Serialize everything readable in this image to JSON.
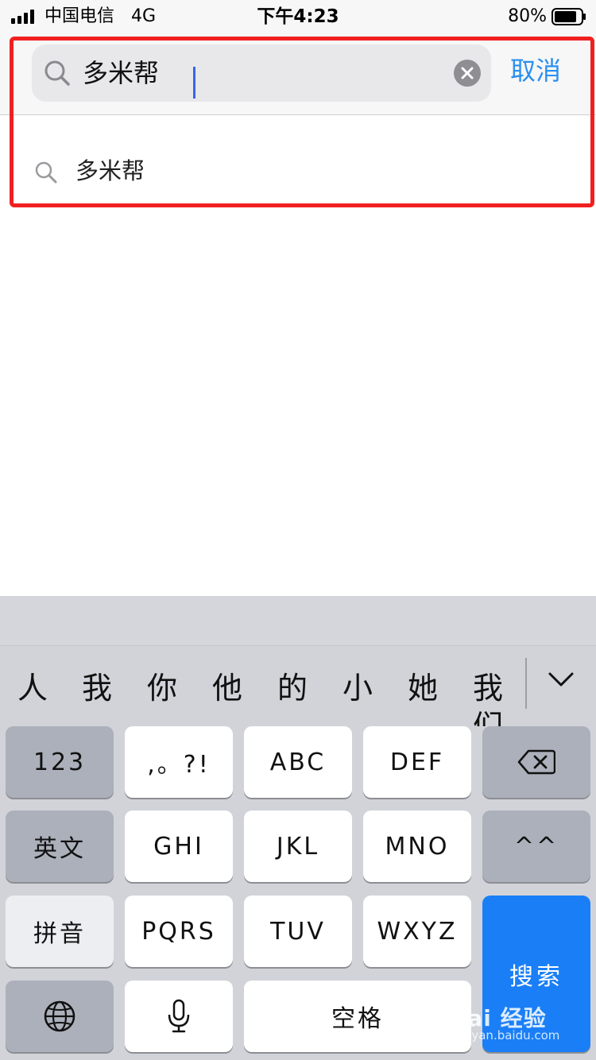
{
  "status_bar": {
    "carrier": "中国电信",
    "network": "4G",
    "time": "下午4:23",
    "battery": "80%"
  },
  "search": {
    "query": "多米帮",
    "cancel_label": "取消"
  },
  "suggestions": [
    {
      "text": "多米帮"
    }
  ],
  "keyboard": {
    "candidates": [
      "人",
      "我",
      "你",
      "他",
      "的",
      "小",
      "她",
      "我们"
    ],
    "rows": [
      [
        "123",
        ",。?!",
        "ABC",
        "DEF"
      ],
      [
        "英文",
        "GHI",
        "JKL",
        "MNO",
        "^^"
      ],
      [
        "拼音",
        "PQRS",
        "TUV",
        "WXYZ"
      ]
    ],
    "space_label": "空格",
    "search_label": "搜索",
    "accent_color": "#1a7ff7"
  },
  "watermark": {
    "logo": "Bai 经验",
    "url": "jingyan.baidu.com"
  },
  "annotation_color": "#f02020"
}
